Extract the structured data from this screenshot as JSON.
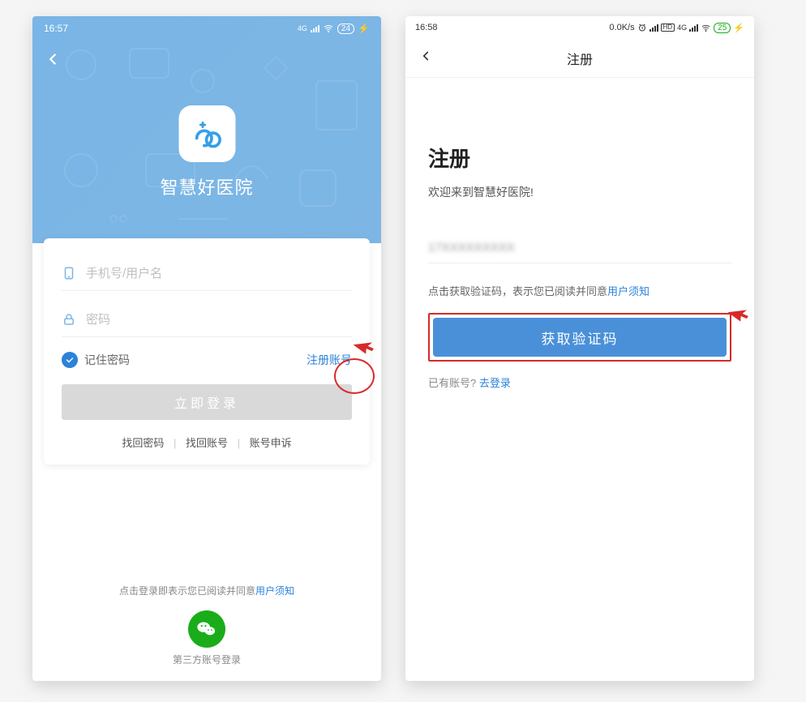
{
  "phone1": {
    "status": {
      "time": "16:57",
      "battery": "24",
      "network": "4G"
    },
    "app_title": "智慧好医院",
    "username_placeholder": "手机号/用户名",
    "password_placeholder": "密码",
    "remember_label": "记住密码",
    "register_link": "注册账号",
    "login_button": "立即登录",
    "find_password": "找回密码",
    "find_account": "找回账号",
    "account_appeal": "账号申诉",
    "consent_prefix": "点击登录即表示您已阅读并同意",
    "consent_link": "用户须知",
    "third_party_label": "第三方账号登录"
  },
  "phone2": {
    "status": {
      "time": "16:58",
      "speed": "0.0K/s",
      "battery": "25",
      "network": "4G"
    },
    "nav_title": "注册",
    "heading": "注册",
    "subtitle": "欢迎来到智慧好医院!",
    "phone_masked": "17XXXXXXXXX",
    "consent_prefix": "点击获取验证码，表示您已阅读并同意",
    "consent_link": "用户须知",
    "get_code_button": "获取验证码",
    "already_prefix": "已有账号? ",
    "go_login": "去登录"
  }
}
